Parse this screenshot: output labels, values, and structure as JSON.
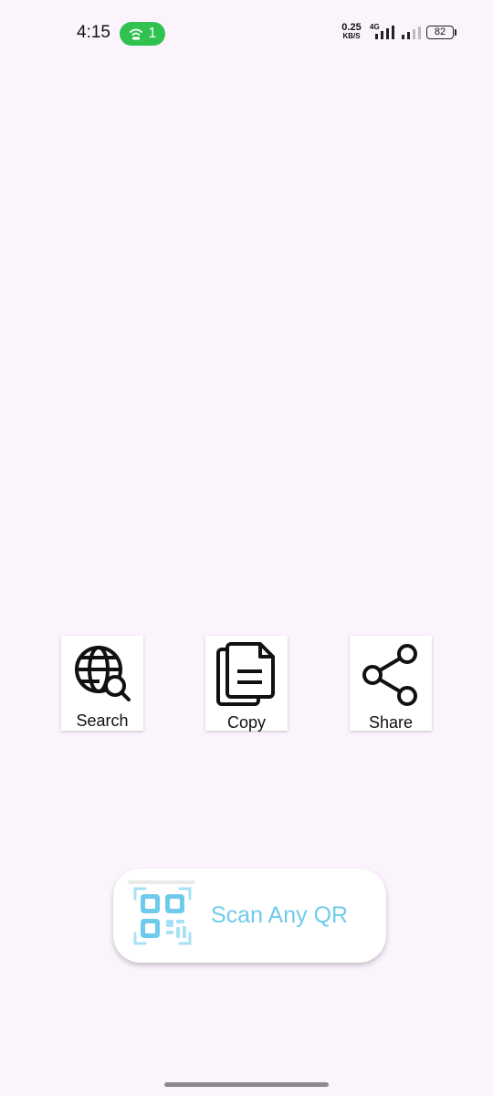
{
  "status_bar": {
    "time": "4:15",
    "hotspot_count": "1",
    "net_speed_value": "0.25",
    "net_speed_unit": "KB/S",
    "network_type": "4G",
    "battery": "82"
  },
  "actions": {
    "search_label": "Search",
    "copy_label": "Copy",
    "share_label": "Share"
  },
  "scan_button": {
    "label": "Scan Any QR",
    "accent_color": "#6fcbeb"
  },
  "colors": {
    "background": "#fcf4fd",
    "hotspot": "#30c24f"
  }
}
